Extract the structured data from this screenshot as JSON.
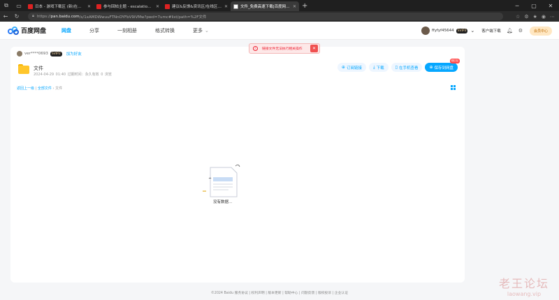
{
  "browser": {
    "tabs": [
      {
        "title": "日本 - 游戏下载区 (新)在游戏&台",
        "active": false
      },
      {
        "title": "参与回帖主题 - escalation(文件",
        "active": false
      },
      {
        "title": "建议&反馈&资讯区/在线区_老王论坛",
        "active": false
      },
      {
        "title": "文件_免费高速下载|百度网盘-分享",
        "active": true
      }
    ],
    "url_prefix": "https://",
    "url_host": "pan.baidu.com",
    "url_rest": "/s/1xAMDWwuuFTNnOYFbV9iVMw?pwd=7umc#list/path=%2F文件"
  },
  "app": {
    "logo_text": "百度网盘",
    "nav": [
      "网盘",
      "分享",
      "一刻相册",
      "格式转换",
      "更多"
    ],
    "active_nav": 0,
    "username": "ffyfyf45644",
    "user_badge": "SVIP3",
    "client_download": "客户端下载",
    "vip_button": "会员中心"
  },
  "share": {
    "sharer_name": "ver****0693",
    "sharer_badge": "SVIP2",
    "follow_label": "加为好友",
    "folder_name": "文件",
    "meta": "2024-04-29 01:40   过期时间：永久有效   0 浏览",
    "actions": {
      "subscribe": "订阅链接",
      "download": "下载",
      "phone": "在手机查看",
      "save": "保存到网盘",
      "save_badge": "领红包"
    },
    "breadcrumb": {
      "back": "返回上一级",
      "all": "全部文件",
      "current": "文件"
    },
    "empty_text": "没有数据..."
  },
  "toast": {
    "message": "链接文件无法执行相关操作"
  },
  "footer": "©2024 Baidu  服务协议 | 权利声明 | 版本更新 | 帮助中心 | 问题反馈 | 版权投诉 | 企业认证",
  "watermark": {
    "line1": "老王论坛",
    "line2": "laowang.vip"
  },
  "colors": {
    "accent": "#06a7ff",
    "toast_red": "#e23333",
    "folder": "#ffc62b"
  }
}
